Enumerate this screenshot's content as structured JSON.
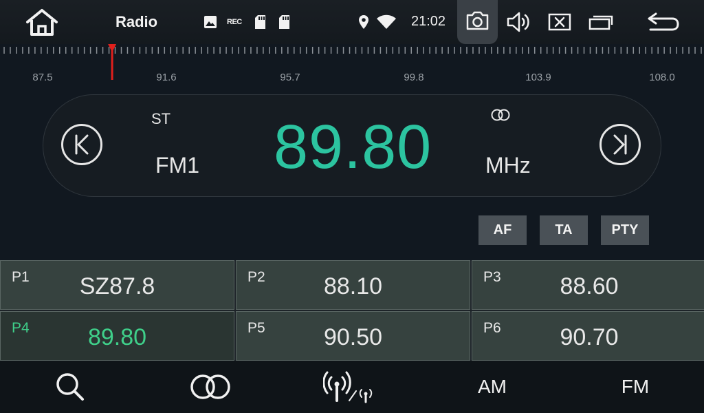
{
  "statusbar": {
    "title": "Radio",
    "time": "21:02",
    "notification_icons": [
      "image-icon",
      "rec-icon",
      "sd-card-icon",
      "sd-card-icon"
    ],
    "rec_text": "REC",
    "icons": [
      "home-icon",
      "location-icon",
      "wifi-icon",
      "camera-icon",
      "volume-icon",
      "close-window-icon",
      "multi-window-icon",
      "back-icon"
    ]
  },
  "dial": {
    "labels": [
      "87.5",
      "91.6",
      "95.7",
      "99.8",
      "103.9",
      "108.0"
    ],
    "min": 87.5,
    "max": 108.0,
    "current": 89.8,
    "marker_color": "#e0201c"
  },
  "tuner": {
    "stereo": "ST",
    "band": "FM1",
    "frequency": "89.80",
    "unit": "MHz",
    "accent_color": "#2cc4a0"
  },
  "rds": {
    "af": "AF",
    "ta": "TA",
    "pty": "PTY"
  },
  "presets": [
    {
      "num": "P1",
      "freq": "SZ87.8",
      "active": false
    },
    {
      "num": "P2",
      "freq": "88.10",
      "active": false
    },
    {
      "num": "P3",
      "freq": "88.60",
      "active": false
    },
    {
      "num": "P4",
      "freq": "89.80",
      "active": true
    },
    {
      "num": "P5",
      "freq": "90.50",
      "active": false
    },
    {
      "num": "P6",
      "freq": "90.70",
      "active": false
    }
  ],
  "toolbar": {
    "search_icon": "search-icon",
    "stereo_icon": "stereo-icon",
    "local_distance_icon": "antenna-icon",
    "am": "AM",
    "fm": "FM"
  }
}
